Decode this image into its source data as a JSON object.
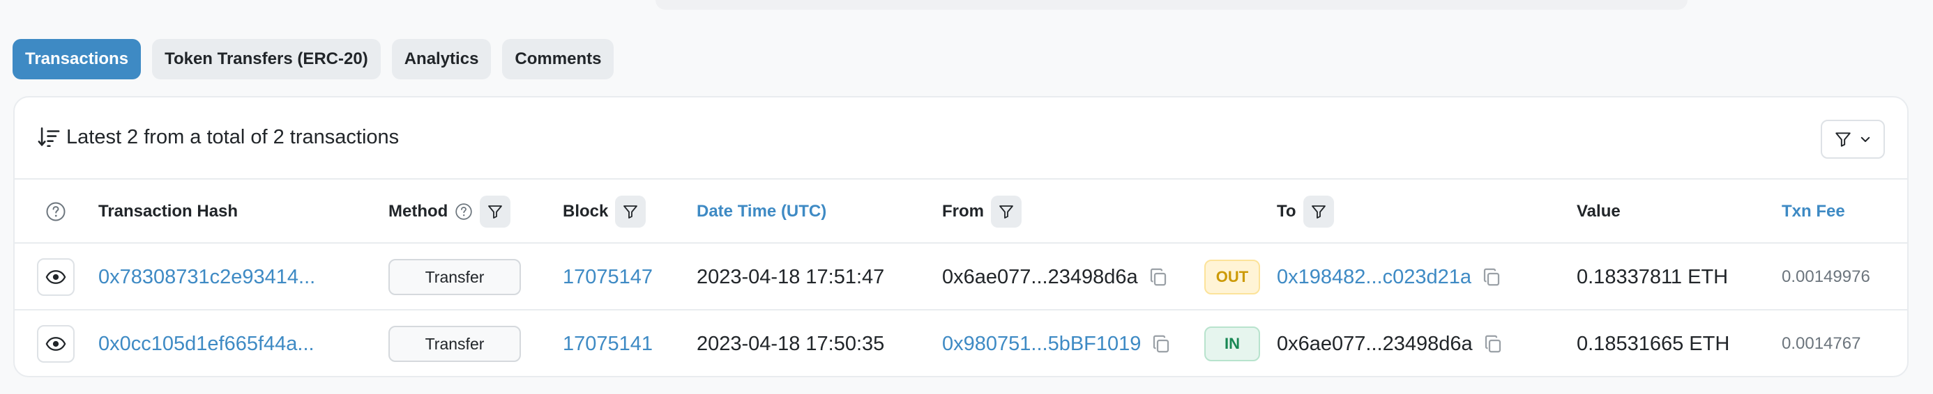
{
  "tabs": [
    {
      "label": "Transactions",
      "active": true
    },
    {
      "label": "Token Transfers (ERC-20)",
      "active": false
    },
    {
      "label": "Analytics",
      "active": false
    },
    {
      "label": "Comments",
      "active": false
    }
  ],
  "summary": {
    "text": "Latest 2 from a total of 2 transactions",
    "icon": "sort-descending-icon"
  },
  "table": {
    "columns": {
      "tx_hash": "Transaction Hash",
      "method": "Method",
      "block": "Block",
      "datetime": "Date Time (UTC)",
      "from": "From",
      "to": "To",
      "value": "Value",
      "fee": "Txn Fee"
    },
    "rows": [
      {
        "tx_hash": "0x78308731c2e93414...",
        "method": "Transfer",
        "block": "17075147",
        "datetime": "2023-04-18 17:51:47",
        "from": "0x6ae077...23498d6a",
        "direction": "OUT",
        "to": "0x198482...c023d21a",
        "value": "0.18337811 ETH",
        "fee": "0.00149976"
      },
      {
        "tx_hash": "0x0cc105d1ef665f44a...",
        "method": "Transfer",
        "block": "17075141",
        "datetime": "2023-04-18 17:50:35",
        "from": "0x980751...5bBF1019",
        "direction": "IN",
        "to": "0x6ae077...23498d6a",
        "value": "0.18531665 ETH",
        "fee": "0.0014767"
      }
    ]
  },
  "colors": {
    "accent": "#3e8ac4",
    "out_badge": "#cc9a06",
    "in_badge": "#198754"
  }
}
